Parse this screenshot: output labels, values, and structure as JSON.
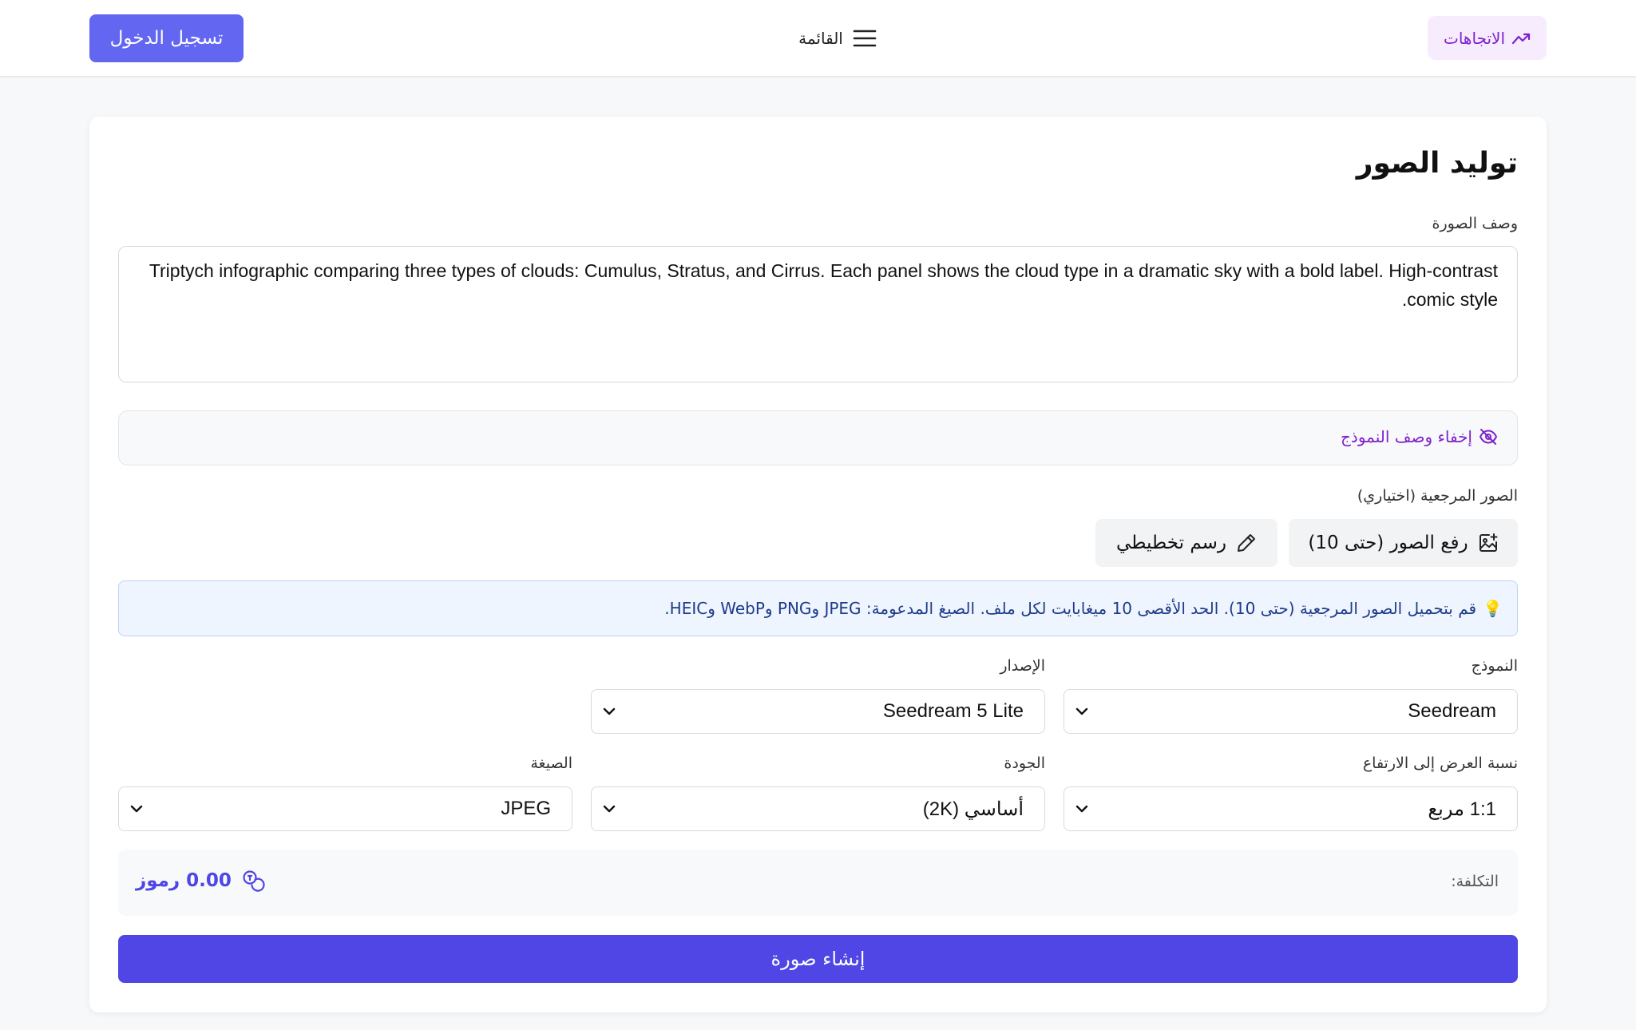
{
  "header": {
    "trends_label": "الاتجاهات",
    "menu_label": "القائمة",
    "login_label": "تسجيل الدخول"
  },
  "page": {
    "title": "توليد الصور",
    "prompt_label": "وصف الصورة",
    "prompt_value": "Triptych infographic comparing three types of clouds: Cumulus, Stratus, and Cirrus. Each panel shows the cloud type in a dramatic sky with a bold label. High-contrast comic style.",
    "hide_prompt_label": "إخفاء وصف النموذج",
    "reference_label": "الصور المرجعية (اختياري)",
    "upload_label": "رفع الصور (حتى 10)",
    "sketch_label": "رسم تخطيطي",
    "info_icon": "💡",
    "info_text": "قم بتحميل الصور المرجعية (حتى 10). الحد الأقصى 10 ميغابايت لكل ملف. الصيغ المدعومة: JPEG وPNG وWebP وHEIC."
  },
  "settings": {
    "model_label": "النموذج",
    "model_value": "Seedream",
    "version_label": "الإصدار",
    "version_value": "Seedream 5 Lite",
    "ratio_label": "نسبة العرض إلى الارتفاع",
    "ratio_value": "1:1 مربع",
    "quality_label": "الجودة",
    "quality_value": "أساسي (2K)",
    "format_label": "الصيغة",
    "format_value": "JPEG"
  },
  "cost": {
    "label": "التكلفة:",
    "value": "0.00 رموز"
  },
  "generate_label": "إنشاء صورة",
  "colors": {
    "accent": "#4f46e5",
    "login": "#6366f1",
    "trends_bg": "#f6ecfd",
    "purple_text": "#7e22ce",
    "info_bg": "#eef5ff"
  },
  "icons": {
    "trends": "trending-icon",
    "menu": "hamburger-icon",
    "hide": "eye-off-icon",
    "upload": "image-plus-icon",
    "sketch": "pencil-icon",
    "cost": "coins-icon",
    "chevron": "chevron-down-icon"
  }
}
